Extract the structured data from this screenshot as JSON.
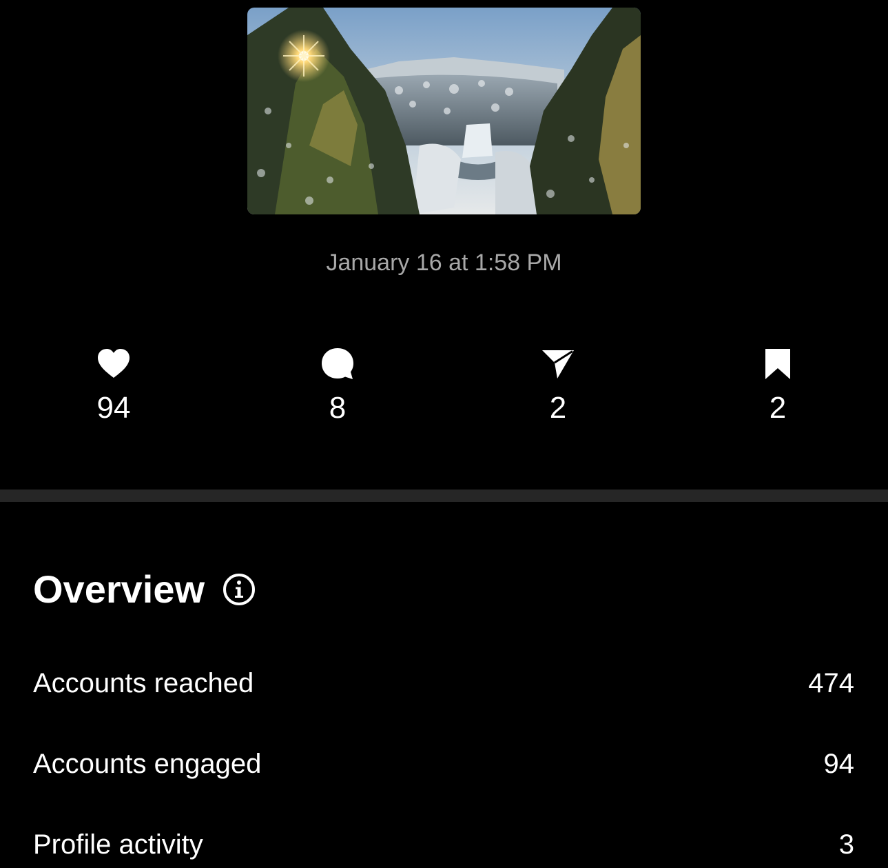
{
  "post": {
    "date": "January 16 at 1:58 PM"
  },
  "stats": [
    {
      "icon": "heart-icon",
      "value": "94"
    },
    {
      "icon": "comment-icon",
      "value": "8"
    },
    {
      "icon": "share-icon",
      "value": "2"
    },
    {
      "icon": "bookmark-icon",
      "value": "2"
    }
  ],
  "overview": {
    "title": "Overview",
    "info_icon": "info-icon",
    "rows": [
      {
        "label": "Accounts reached",
        "value": "474"
      },
      {
        "label": "Accounts engaged",
        "value": "94"
      },
      {
        "label": "Profile activity",
        "value": "3"
      }
    ]
  },
  "colors": {
    "background": "#000000",
    "text": "#ffffff",
    "muted_text": "#a8a8a8",
    "divider": "#262626"
  }
}
